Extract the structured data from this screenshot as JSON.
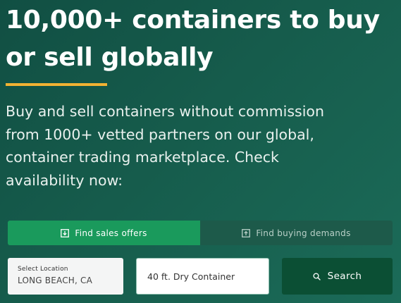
{
  "hero": {
    "title": "10,000+ containers to buy or sell globally",
    "subtitle": "Buy and sell containers without commission from 1000+ vetted partners on our global, container trading marketplace. Check availability now:"
  },
  "tabs": [
    {
      "label": "Find sales offers",
      "icon": "download-box-icon",
      "active": true
    },
    {
      "label": "Find buying demands",
      "icon": "upload-box-icon",
      "active": false
    }
  ],
  "search": {
    "location_label": "Select Location",
    "location_value": "LONG BEACH, CA",
    "container_value": "40 ft. Dry Container",
    "button_label": "Search",
    "button_icon": "search-icon"
  },
  "colors": {
    "background": "#165c4c",
    "accent": "#f2b233",
    "tab_active": "#1a9a5c",
    "tab_inactive": "#1d5a4a",
    "search_button": "#0b4f34"
  }
}
